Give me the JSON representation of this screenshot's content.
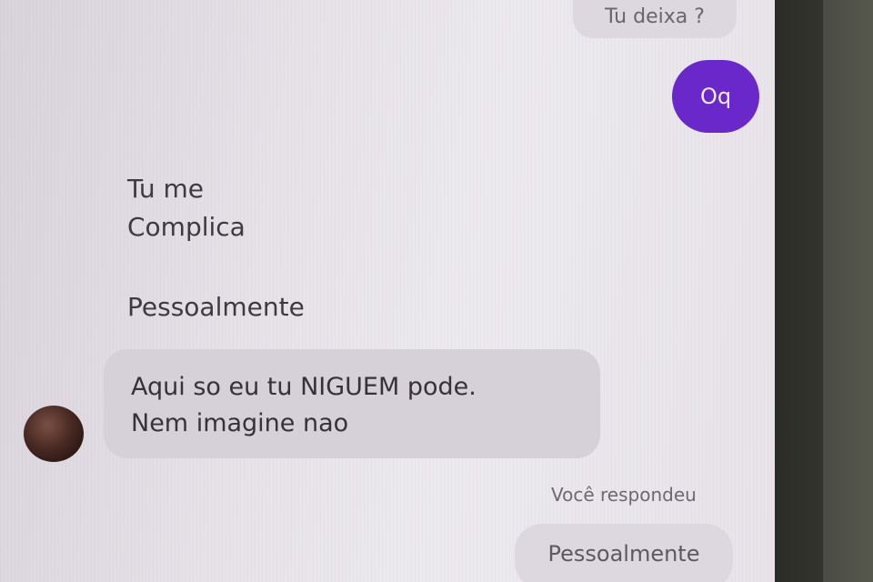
{
  "conversation": {
    "messages": [
      {
        "sender": "self",
        "text": "Tu deixa ?"
      },
      {
        "sender": "self",
        "text": "Oq"
      },
      {
        "sender": "other",
        "text": "Tu me"
      },
      {
        "sender": "other",
        "text": "Complica"
      },
      {
        "sender": "other",
        "text": "Pessoalmente"
      },
      {
        "sender": "other",
        "lines": [
          "Aqui so eu tu  NIGUEM pode.",
          "Nem imagine nao"
        ]
      }
    ],
    "reply": {
      "caption": "Você respondeu",
      "text": "Pessoalmente"
    }
  },
  "colors": {
    "accent": "#6a27c9",
    "background": "#e6e2e8",
    "bubble_incoming": "#d6d0d8"
  }
}
